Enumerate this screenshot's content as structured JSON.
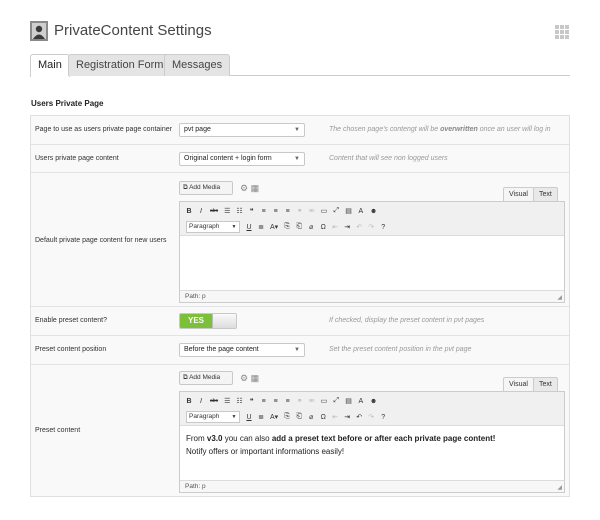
{
  "header": {
    "title": "PrivateContent Settings",
    "logo_icon": "user-silhouette-icon",
    "grid_icon": "grid-icon"
  },
  "tabs": [
    {
      "label": "Main",
      "active": true
    },
    {
      "label": "Registration Form",
      "active": false
    },
    {
      "label": "Messages",
      "active": false
    }
  ],
  "section_title": "Users Private Page",
  "rows": {
    "container": {
      "label": "Page to use as users private page container",
      "value": "pvt page",
      "hint_pre": "The chosen page's contengt will be ",
      "hint_bold": "overwritten",
      "hint_post": " once an user will log in"
    },
    "content": {
      "label": "Users private page content",
      "value": "Original content + login form",
      "hint": "Content that will see non logged users"
    },
    "default_content": {
      "label": "Default private page content for new users",
      "add_media": "Add Media",
      "tab_visual": "Visual",
      "tab_text": "Text",
      "format": "Paragraph",
      "path": "Path: p"
    },
    "enable_preset": {
      "label": "Enable preset content?",
      "toggle": "YES",
      "hint": "If checked, display the preset content in pvt pages"
    },
    "preset_position": {
      "label": "Preset content position",
      "value": "Before the page content",
      "hint": "Set the preset content position in the pvt page"
    },
    "preset_content": {
      "label": "Preset content",
      "add_media": "Add Media",
      "tab_visual": "Visual",
      "tab_text": "Text",
      "format": "Paragraph",
      "path": "Path: p",
      "text_from": "From ",
      "text_version": "v3.0",
      "text_mid": " you can also ",
      "text_bold": "add a preset text before or after each private page content!",
      "text_line2": "Notify offers or important informations easily!"
    }
  },
  "colors": {
    "toggle_on": "#7cc03a",
    "border": "#dfdfdf",
    "row_bg": "#f9f9f9"
  }
}
